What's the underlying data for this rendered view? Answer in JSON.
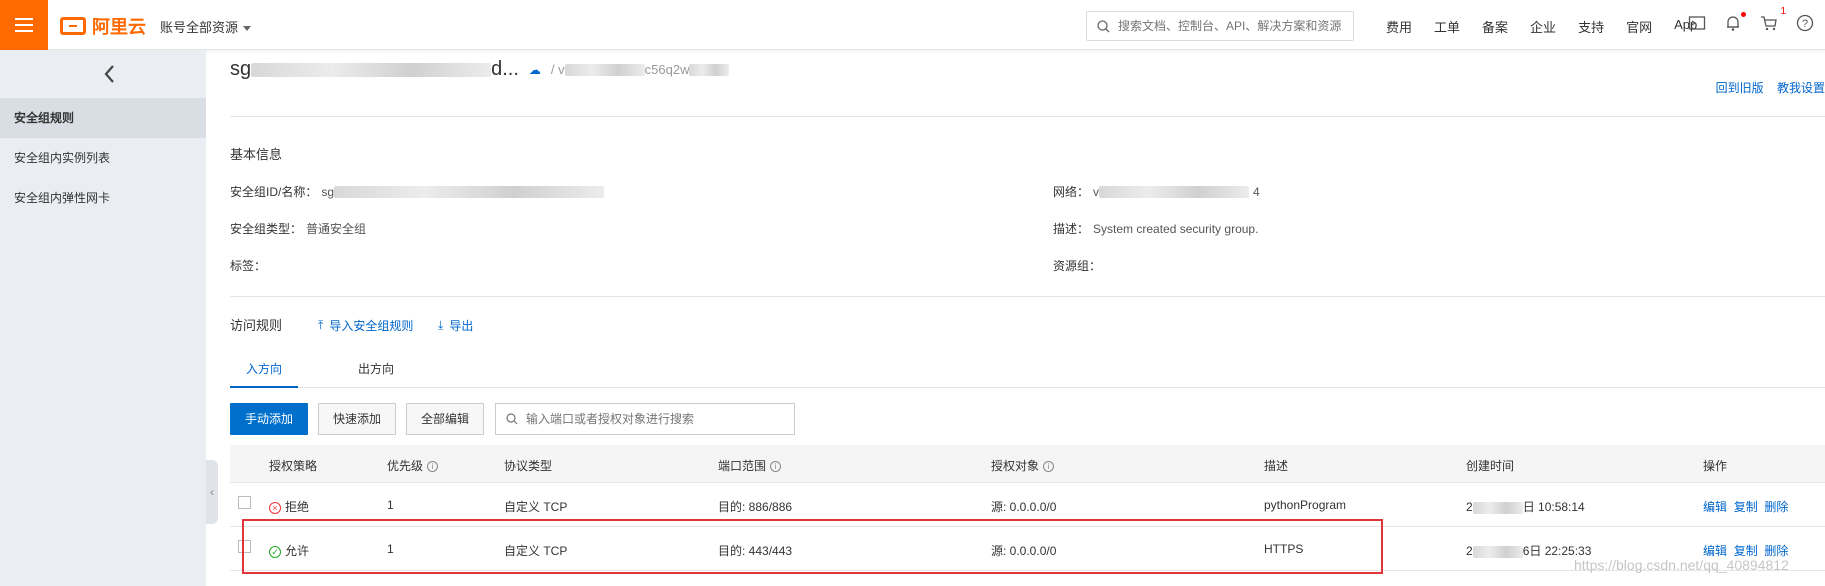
{
  "header": {
    "logo_text": "阿里云",
    "account_scope": "账号全部资源",
    "search_placeholder": "搜索文档、控制台、API、解决方案和资源",
    "links": [
      "费用",
      "工单",
      "备案",
      "企业",
      "支持",
      "官网",
      "App"
    ],
    "cart_count": "1"
  },
  "sidebar": {
    "items": [
      {
        "label": "安全组规则",
        "active": true
      },
      {
        "label": "安全组内实例列表",
        "active": false
      },
      {
        "label": "安全组内弹性网卡",
        "active": false
      }
    ]
  },
  "page": {
    "title_start": "sg",
    "title_end": "d...",
    "vpc_start": "/ v",
    "vpc_end": "c56q2w",
    "back_old": "回到旧版",
    "tutorial": "教我设置"
  },
  "basic_info": {
    "section_title": "基本信息",
    "id_label": "安全组ID/名称：",
    "id_value": "sg",
    "network_label": "网络：",
    "network_value": "v",
    "network_value_end": "4",
    "type_label": "安全组类型：",
    "type_value": "普通安全组",
    "desc_label": "描述：",
    "desc_value": "System created security group.",
    "tag_label": "标签：",
    "rg_label": "资源组："
  },
  "rules": {
    "section_title": "访问规则",
    "import": "导入安全组规则",
    "export": "导出",
    "tabs": [
      "入方向",
      "出方向"
    ],
    "buttons": {
      "manual_add": "手动添加",
      "quick_add": "快速添加",
      "edit_all": "全部编辑"
    },
    "filter_placeholder": "输入端口或者授权对象进行搜索",
    "columns": [
      "授权策略",
      "优先级",
      "协议类型",
      "端口范围",
      "授权对象",
      "描述",
      "创建时间",
      "操作"
    ],
    "rows": [
      {
        "policy": "拒绝",
        "policy_type": "deny",
        "priority": "1",
        "protocol": "自定义 TCP",
        "port": "目的: 886/886",
        "source": "源: 0.0.0.0/0",
        "description": "pythonProgram",
        "created_start": "2",
        "created_end": "日 10:58:14",
        "actions": [
          "编辑",
          "复制",
          "删除"
        ]
      },
      {
        "policy": "允许",
        "policy_type": "allow",
        "priority": "1",
        "protocol": "自定义 TCP",
        "port": "目的: 443/443",
        "source": "源: 0.0.0.0/0",
        "description": "HTTPS",
        "created_start": "2",
        "created_end": "6日 22:25:33",
        "actions": [
          "编辑",
          "复制",
          "删除"
        ]
      }
    ]
  },
  "watermark": "https://blog.csdn.net/qq_40894812"
}
